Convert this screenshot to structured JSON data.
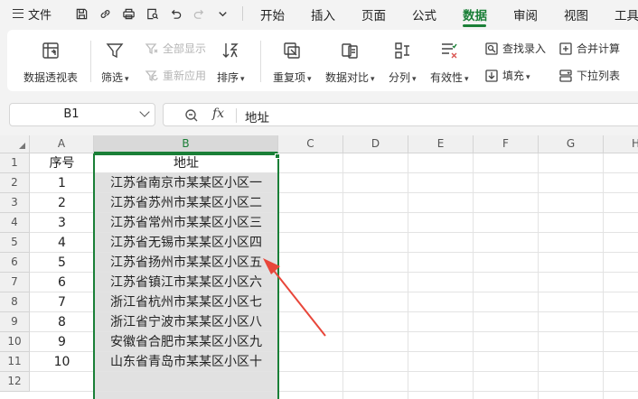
{
  "menubar": {
    "file_label": "文件",
    "tabs": [
      "开始",
      "插入",
      "页面",
      "公式",
      "数据",
      "审阅",
      "视图",
      "工具"
    ],
    "active_tab": "数据"
  },
  "ribbon": {
    "pivot_table": "数据透视表",
    "filter": "筛选",
    "show_all": "全部显示",
    "reapply": "重新应用",
    "sort": "排序",
    "duplicates": "重复项",
    "compare": "数据对比",
    "split": "分列",
    "validity": "有效性",
    "find_entry": "查找录入",
    "fill": "填充",
    "consolidate": "合并计算",
    "dropdown_list": "下拉列表"
  },
  "formula_bar": {
    "cell_ref": "B1",
    "fx_label": "fx",
    "value": "地址"
  },
  "grid": {
    "columns": [
      "A",
      "B",
      "C",
      "D",
      "E",
      "F",
      "G",
      "H"
    ],
    "selected_column": "B",
    "row_numbers": [
      "1",
      "2",
      "3",
      "4",
      "5",
      "6",
      "7",
      "8",
      "9",
      "10",
      "11",
      "12"
    ],
    "header_row": {
      "a": "序号",
      "b": "地址"
    },
    "rows": [
      {
        "a": "1",
        "b": "江苏省南京市某某区小区一"
      },
      {
        "a": "2",
        "b": "江苏省苏州市某某区小区二"
      },
      {
        "a": "3",
        "b": "江苏省常州市某某区小区三"
      },
      {
        "a": "4",
        "b": "江苏省无锡市某某区小区四"
      },
      {
        "a": "5",
        "b": "江苏省扬州市某某区小区五"
      },
      {
        "a": "6",
        "b": "江苏省镇江市某某区小区六"
      },
      {
        "a": "7",
        "b": "浙江省杭州市某某区小区七"
      },
      {
        "a": "8",
        "b": "浙江省宁波市某某区小区八"
      },
      {
        "a": "9",
        "b": "安徽省合肥市某某区小区九"
      },
      {
        "a": "10",
        "b": "山东省青岛市某某区小区十"
      }
    ]
  },
  "colors": {
    "accent": "#1a7f37",
    "annotation_arrow": "#e8463a"
  }
}
